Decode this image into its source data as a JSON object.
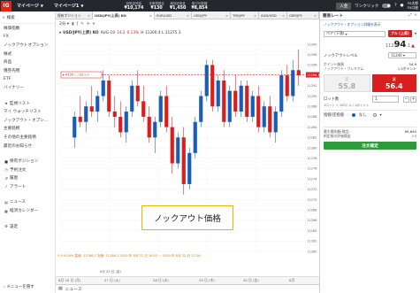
{
  "topbar": {
    "logo": "IG",
    "tab1": "マイページ",
    "tab2": "マイページ1",
    "stats": [
      {
        "value": "¥10,174",
        "label": "証拠金残高"
      },
      {
        "value": "¥130",
        "label": "未実現損益"
      },
      {
        "value": "¥1,450",
        "label": "維持証拠金"
      },
      {
        "value": "¥8,854",
        "label": "取引可能額"
      }
    ],
    "entry": "入金",
    "one_click": "ワンクリック",
    "user_name": "FX太郎",
    "user_sub": "FX口座"
  },
  "sidebar": {
    "search": "検索",
    "items": [
      "株価指数",
      "FX",
      "ノックアウトオプション",
      "株式",
      "商品",
      "債券先物",
      "ETF",
      "バイナリー"
    ],
    "items2": [
      "監視リスト",
      "マイ ウォッチリスト",
      "ノックアウト・オプシ...",
      "主要銘柄",
      "その他の主要銘柄",
      "最近のお知らせ"
    ],
    "items3": [
      "保有ポジション",
      "予約注文",
      "履歴",
      "アラート"
    ],
    "items4": [
      "ニュース",
      "経済カレンダー"
    ],
    "settings": "設定",
    "hide_menu": "メニューを隠す"
  },
  "tabs": [
    {
      "label": "保有ポジション"
    },
    {
      "label": "USD/JPY(上昇) KO"
    },
    {
      "label": "EUR/USD"
    },
    {
      "label": "USD/JPY"
    },
    {
      "label": "TRY/JPY"
    },
    {
      "label": "AUD/USD"
    },
    {
      "label": "GBP/JPY"
    }
  ],
  "chart": {
    "timeframe": "2分",
    "symbol": "USD/JPY(上昇) KO",
    "contract": "AUG-19",
    "change": "14.2",
    "change_pct": "0.13%",
    "ohlc": "H 11300.4 L 11275.3",
    "ko_label": "▸ ¥130 ⬚ 1ロット",
    "current_price": "11294.1",
    "knockout_label": "ノックアウト価格",
    "bottom_info": "5.9   0.09%   高値: 11286.2   安値: 11286.2   2019 年 8月 22 日 16:15 ~ 2019 年 8月 22 日 17:26",
    "bottom_axis": "8月 23 日 (金)",
    "time_axis2": [
      "8月 26 日 (月)",
      "27 日 (火)",
      "28 日 (水)",
      "29 日 (木)",
      "30 日 (金)",
      "8月"
    ]
  },
  "chart_data": {
    "type": "line",
    "title": "",
    "y_ticks": [
      11300,
      11298,
      11296,
      11294,
      11292,
      11290,
      11288,
      11286,
      11284,
      11282,
      11280,
      11278,
      11276,
      11274,
      11272,
      11270,
      11268,
      11266,
      11264,
      11262,
      11260
    ],
    "candles": [
      [
        11282,
        11287,
        11280,
        11286
      ],
      [
        11286,
        11290,
        11284,
        11285
      ],
      [
        11285,
        11289,
        11283,
        11288
      ],
      [
        11288,
        11292,
        11286,
        11287
      ],
      [
        11287,
        11291,
        11285,
        11290
      ],
      [
        11290,
        11295,
        11289,
        11293
      ],
      [
        11293,
        11294,
        11286,
        11287
      ],
      [
        11287,
        11290,
        11284,
        11286
      ],
      [
        11286,
        11289,
        11282,
        11283
      ],
      [
        11283,
        11288,
        11281,
        11287
      ],
      [
        11287,
        11293,
        11286,
        11292
      ],
      [
        11292,
        11295,
        11288,
        11289
      ],
      [
        11289,
        11292,
        11285,
        11286
      ],
      [
        11286,
        11288,
        11281,
        11282
      ],
      [
        11282,
        11286,
        11279,
        11285
      ],
      [
        11285,
        11291,
        11284,
        11290
      ],
      [
        11290,
        11292,
        11283,
        11284
      ],
      [
        11284,
        11286,
        11275,
        11277
      ],
      [
        11277,
        11283,
        11276,
        11282
      ],
      [
        11282,
        11284,
        11271,
        11273
      ],
      [
        11273,
        11280,
        11272,
        11279
      ],
      [
        11279,
        11286,
        11278,
        11285
      ],
      [
        11285,
        11291,
        11284,
        11290
      ],
      [
        11290,
        11297,
        11289,
        11296
      ],
      [
        11296,
        11297,
        11287,
        11288
      ],
      [
        11288,
        11294,
        11287,
        11293
      ],
      [
        11293,
        11295,
        11284,
        11285
      ],
      [
        11285,
        11292,
        11284,
        11291
      ],
      [
        11291,
        11294,
        11286,
        11287
      ],
      [
        11287,
        11293,
        11286,
        11292
      ],
      [
        11292,
        11293,
        11285,
        11286
      ],
      [
        11286,
        11291,
        11285,
        11290
      ],
      [
        11290,
        11292,
        11283,
        11284
      ],
      [
        11284,
        11289,
        11283,
        11288
      ],
      [
        11288,
        11290,
        11282,
        11283
      ],
      [
        11283,
        11288,
        11281,
        11287
      ],
      [
        11287,
        11295,
        11286,
        11294
      ],
      [
        11294,
        11296,
        11289,
        11290
      ],
      [
        11290,
        11297,
        11289,
        11295
      ],
      [
        11295,
        11299,
        11292,
        11294
      ]
    ],
    "ko_level": 11294.1,
    "knockout_level": 11254
  },
  "panel": {
    "title": "簡易レート",
    "link": "ノックアウト・オプション詳細を表示",
    "pair": "ペア (下落)",
    "bull": "ブル (上昇)",
    "price_small": "112",
    "price_big": "94",
    "price_sup": ".1",
    "knock_level_label": "ノックアウトレベル",
    "knock_level": "11240",
    "kv1": [
      {
        "k": "ポイント価値",
        "v": "54.9"
      },
      {
        "k": "ノックアウト・プレミアム",
        "v": "1.5ポイント"
      }
    ],
    "sell_label": "売",
    "sell_price": "55.8",
    "buy_label": "買",
    "buy_price": "56.4",
    "lot_label": "ロット数",
    "lot_value": "1",
    "lot_note": "1ロット = 100ドル / 1ポイント",
    "order_label": "指値/逆指値",
    "order_value": "なし",
    "kv2": [
      {
        "k": "最大損失額(推定)",
        "v": "¥5,640"
      },
      {
        "k": "約定前の評価損益",
        "v": "+2"
      }
    ],
    "confirm": "注文確定"
  },
  "newsbar": {
    "label": "ニュース"
  }
}
